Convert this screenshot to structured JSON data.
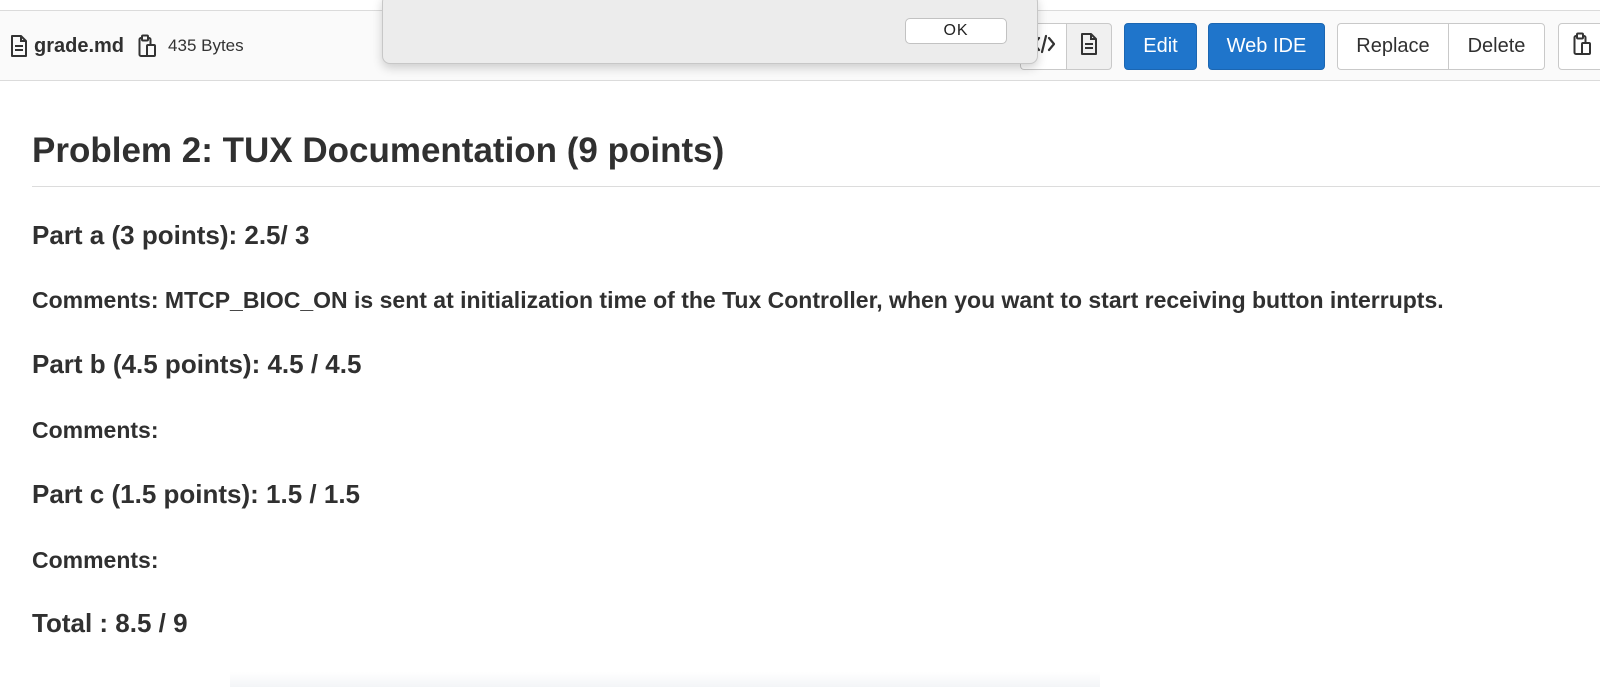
{
  "file": {
    "name": "grade.md",
    "size": "435 Bytes",
    "file_icon": "file-text-icon",
    "copy_icon": "clipboard-icon"
  },
  "toolbar": {
    "source_icon": "code-icon",
    "rendered_icon": "file-text-icon",
    "edit_label": "Edit",
    "web_ide_label": "Web IDE",
    "replace_label": "Replace",
    "delete_label": "Delete",
    "copy_icon": "clipboard-icon"
  },
  "dialog": {
    "ok_label": "OK"
  },
  "document": {
    "title": "Problem 2: TUX Documentation (9 points)",
    "part_a": "Part a (3 points): 2.5/ 3",
    "comment_a": "Comments: MTCP_BIOC_ON is sent at initialization time of the Tux Controller, when you want to start receiving button interrupts.",
    "part_b": "Part b (4.5 points): 4.5 / 4.5",
    "comment_b": "Comments:",
    "part_c": "Part c (1.5 points): 1.5 / 1.5",
    "comment_c": "Comments:",
    "total": "Total : 8.5 / 9"
  },
  "colors": {
    "primary_button": "#1f75cb",
    "header_background": "#fafafa",
    "text": "#303030"
  }
}
